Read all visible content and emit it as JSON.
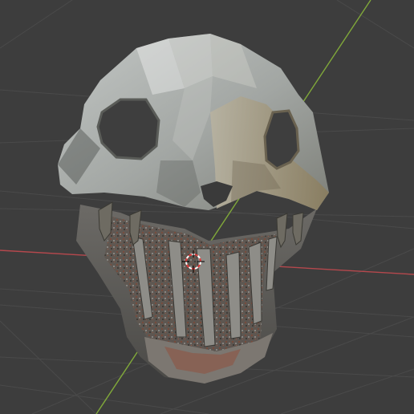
{
  "viewport": {
    "background_color": "#3d3d3d",
    "grid_color": "#4a4a4a",
    "x_axis_color": "#b5484d",
    "y_axis_color": "#80a83a"
  },
  "object": {
    "type": "skull-mask",
    "base_color": "#8e9390",
    "shadow_color": "#4a4d4a",
    "highlight_color": "#cdcfcd",
    "tooth_color": "#6c6a60",
    "rust_color": "#7a4a3a"
  },
  "cursor": {
    "icon": "3d-cursor-icon",
    "ring_color_a": "#e23a3a",
    "ring_color_b": "#ffffff"
  }
}
